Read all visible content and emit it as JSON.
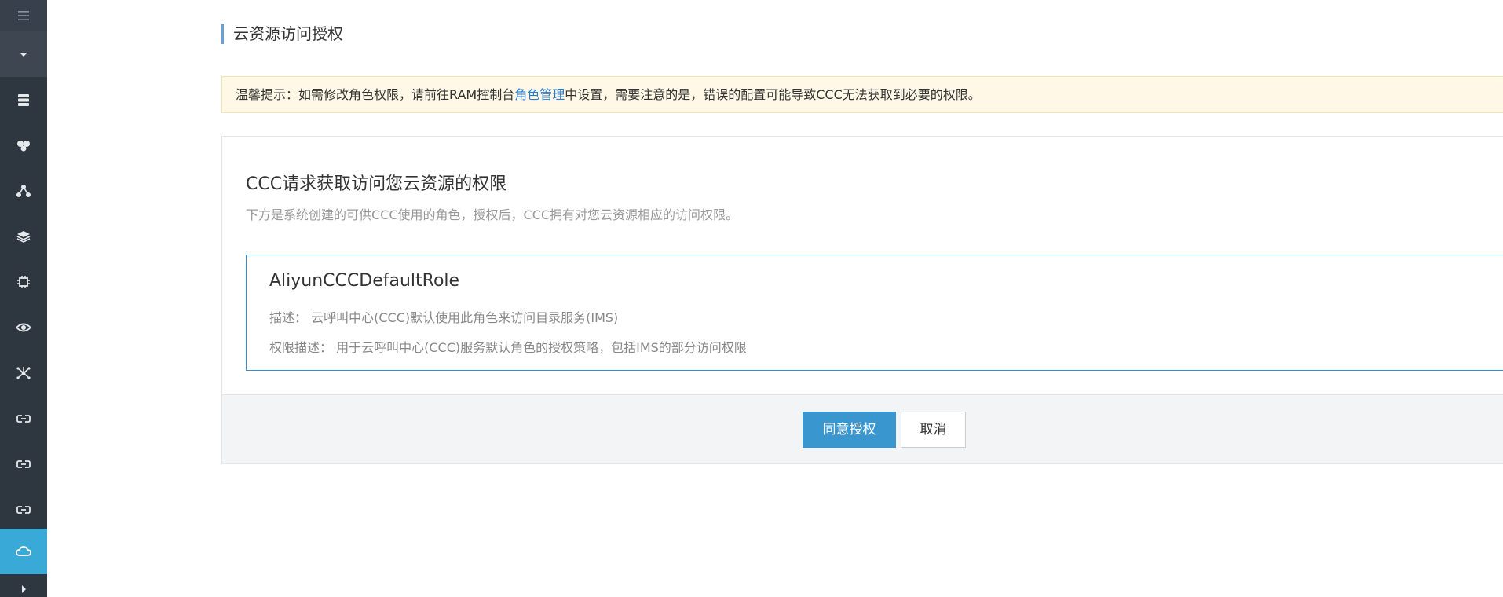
{
  "sidebar": {
    "items": [
      {
        "icon": "menu-icon"
      },
      {
        "icon": "chevron-down-icon"
      },
      {
        "icon": "server-icon"
      },
      {
        "icon": "cloud-nodes-icon"
      },
      {
        "icon": "network-icon"
      },
      {
        "icon": "layers-icon"
      },
      {
        "icon": "chip-icon"
      },
      {
        "icon": "eye-icon"
      },
      {
        "icon": "molecule-icon"
      },
      {
        "icon": "link-icon"
      },
      {
        "icon": "link-icon"
      },
      {
        "icon": "link-icon"
      },
      {
        "icon": "cloud-icon",
        "active": true
      },
      {
        "icon": "arrow-right-icon"
      }
    ],
    "colors": {
      "background": "#2e3640",
      "active": "#39a9d8"
    }
  },
  "page": {
    "title": "云资源访问授权"
  },
  "notice": {
    "prefix": "温馨提示：如需修改角色权限，请前往RAM控制台",
    "link": "角色管理",
    "suffix": "中设置，需要注意的是，错误的配置可能导致CCC无法获取到必要的权限。"
  },
  "card": {
    "title": "CCC请求获取访问您云资源的权限",
    "subtitle": "下方是系统创建的可供CCC使用的角色，授权后，CCC拥有对您云资源相应的访问权限。",
    "role": {
      "name": "AliyunCCCDefaultRole",
      "desc_label": "描述：",
      "desc_value": "云呼叫中心(CCC)默认使用此角色来访问目录服务(IMS)",
      "perm_label": "权限描述：",
      "perm_value": "用于云呼叫中心(CCC)服务默认角色的授权策略，包括IMS的部分访问权限"
    }
  },
  "buttons": {
    "agree": "同意授权",
    "cancel": "取消"
  }
}
